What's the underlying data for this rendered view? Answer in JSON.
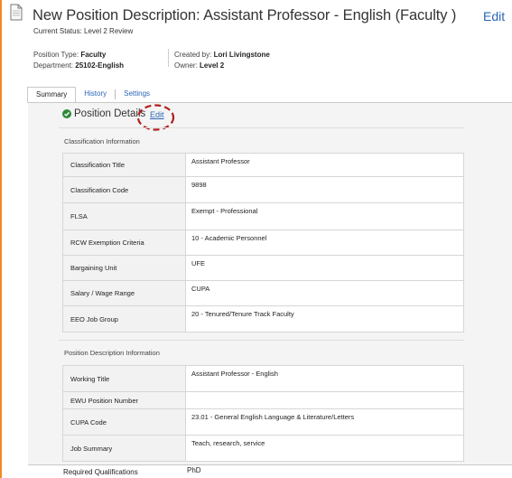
{
  "header": {
    "title": "New Position Description: Assistant Professor - English (Faculty )",
    "edit_label": "Edit",
    "current_status": "Current Status: Level 2 Review",
    "position_type_label": "Position Type:",
    "position_type_value": "Faculty",
    "department_label": "Department:",
    "department_value": "25102-English",
    "created_by_label": "Created by:",
    "created_by_value": "Lori Livingstone",
    "owner_label": "Owner:",
    "owner_value": "Level 2"
  },
  "tabs": [
    {
      "label": "Summary",
      "active": true
    },
    {
      "label": "History",
      "active": false
    },
    {
      "label": "Settings",
      "active": false
    }
  ],
  "section": {
    "title": "Position Details",
    "edit_label": "Edit"
  },
  "classification": {
    "heading": "Classification Information",
    "rows": [
      {
        "label": "Classification Title",
        "value": "Assistant Professor"
      },
      {
        "label": "Classification Code",
        "value": "9898"
      },
      {
        "label": "FLSA",
        "value": "Exempt - Professional"
      },
      {
        "label": "RCW Exemption Criteria",
        "value": "10 - Academic Personnel"
      },
      {
        "label": "Bargaining Unit",
        "value": "UFE"
      },
      {
        "label": "Salary / Wage Range",
        "value": "CUPA"
      },
      {
        "label": "EEO Job Group",
        "value": "20 - Tenured/Tenure Track Faculty"
      }
    ]
  },
  "position_description": {
    "heading": "Position Description Information",
    "rows": [
      {
        "label": "Working Title",
        "value": "Assistant Professor - English"
      },
      {
        "label": "EWU Position Number",
        "value": ""
      },
      {
        "label": "CUPA Code",
        "value": "23.01 - General English Language & Literature/Letters"
      },
      {
        "label": "Job Summary",
        "value": "Teach, research, service"
      }
    ]
  },
  "required_qualifications": {
    "label": "Required Qualifications",
    "value": "PhD"
  },
  "colors": {
    "link": "#2a66b8",
    "success": "#2e8b3a",
    "annotation": "#b01e1e",
    "frame_accent": "#f08a24"
  },
  "icons": {
    "document": "document-icon",
    "status": "check-circle-icon"
  }
}
